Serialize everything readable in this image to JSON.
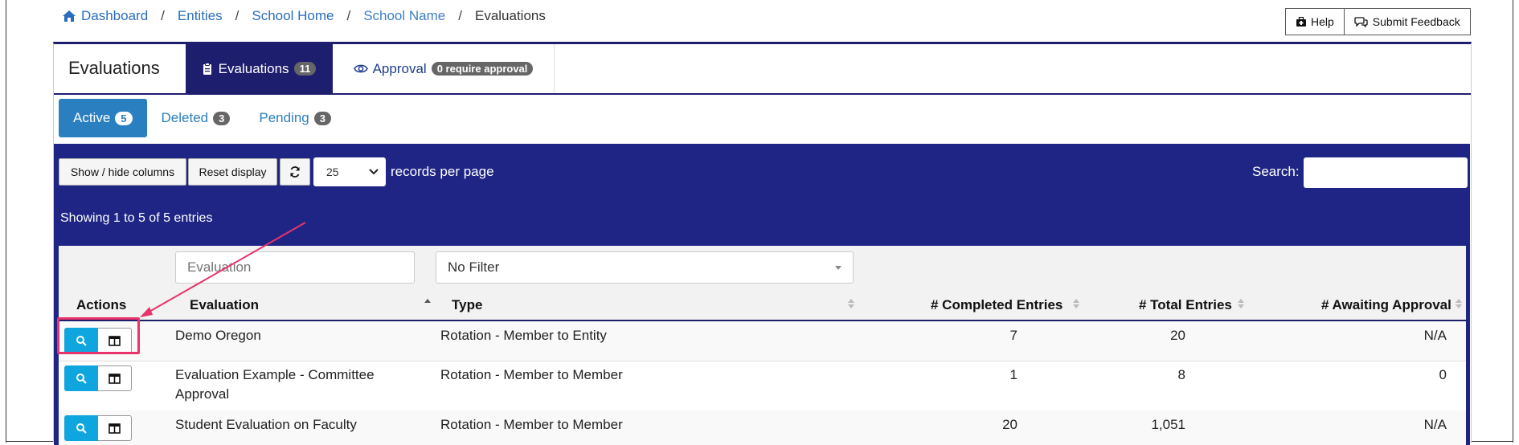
{
  "breadcrumb": {
    "items": [
      "Dashboard",
      "Entities",
      "School Home",
      "School Name"
    ],
    "current": "Evaluations",
    "separator": "/"
  },
  "header_buttons": {
    "help": "Help",
    "feedback": "Submit Feedback"
  },
  "tabs": {
    "title": "Evaluations",
    "evaluations": {
      "label": "Evaluations",
      "count": "11"
    },
    "approval": {
      "label": "Approval",
      "badge": "0 require approval"
    }
  },
  "subtabs": [
    {
      "label": "Active",
      "count": "5"
    },
    {
      "label": "Deleted",
      "count": "3"
    },
    {
      "label": "Pending",
      "count": "3"
    }
  ],
  "toolbar": {
    "show_hide": "Show / hide columns",
    "reset": "Reset display",
    "per_page": "25",
    "records_label": "records per page",
    "search_label": "Search:",
    "search_value": ""
  },
  "showing": "Showing 1 to 5 of 5 entries",
  "filters": {
    "evaluation_placeholder": "Evaluation",
    "type_value": "No Filter"
  },
  "columns": {
    "actions": "Actions",
    "evaluation": "Evaluation",
    "type": "Type",
    "completed": "# Completed Entries",
    "total": "# Total Entries",
    "awaiting": "# Awaiting Approval"
  },
  "rows": [
    {
      "evaluation": "Demo Oregon",
      "type": "Rotation - Member to Entity",
      "completed": "7",
      "total": "20",
      "awaiting": "N/A"
    },
    {
      "evaluation": "Evaluation Example - Committee Approval",
      "type": "Rotation - Member to Member",
      "completed": "1",
      "total": "8",
      "awaiting": "0"
    },
    {
      "evaluation": "Student Evaluation on Faculty",
      "type": "Rotation - Member to Member",
      "completed": "20",
      "total": "1,051",
      "awaiting": "N/A"
    }
  ],
  "colors": {
    "navy": "#1e1e6e",
    "panel": "#1f2585",
    "link": "#2a7fc0",
    "action_blue": "#0fa6e0",
    "annotation": "#e8336b"
  },
  "icons": [
    "home-icon",
    "first-aid-icon",
    "chat-icon",
    "clipboard-icon",
    "eye-icon",
    "refresh-icon",
    "search-icon",
    "columns-icon"
  ]
}
